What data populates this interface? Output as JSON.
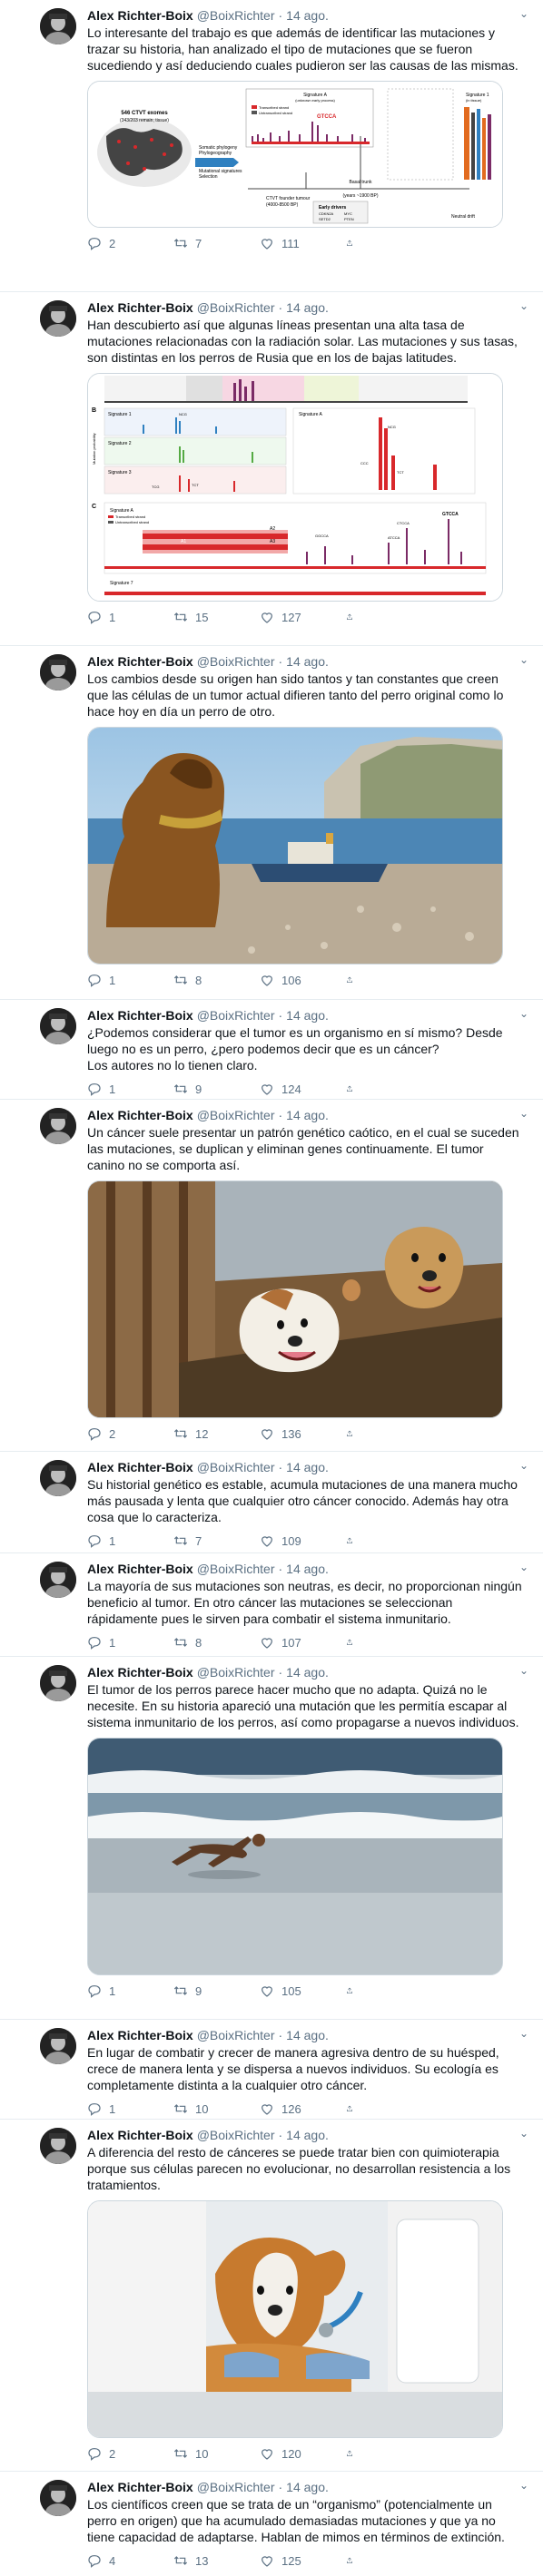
{
  "author": {
    "name": "Alex Richter-Boix",
    "handle": "@BoixRichter",
    "sep": "·"
  },
  "tweets": [
    {
      "time": "14 ago.",
      "text": "Lo interesante del trabajo es que además de identificar las mutaciones y trazar su historia, han analizado el tipo de mutaciones que se fueron sucediendo y así deduciendo cuales pudieron ser las causas de las mismas.",
      "replies": "2",
      "retweets": "7",
      "likes": "111",
      "figure": {
        "map_title": "546 CTVT exomes",
        "map_sub": "(343/203 remain; tissue)",
        "arrow_lines": [
          "Somatic phylogeny",
          "Phylogeography",
          "Mutational signatures",
          "Selection"
        ],
        "founder": "CTVT\nfounder tumour",
        "founder_date": "(4000-8500 BP)",
        "basal": "Basal trunk",
        "basal_date": "(years ~1900 BP)",
        "drivers": "Early drivers",
        "driver_genes": [
          "CDKN2A",
          "MYC",
          "SETD2",
          "PTEN",
          "RB1"
        ],
        "sigA": "Signature A",
        "sigA_sub": "(unknown early process)",
        "sig1": "Signature 1",
        "sig1_sub": "(in tissue)",
        "seq": "GTCCA",
        "drift": "Neutral drift",
        "leg1": "Transcribed strand",
        "leg2": "Untranscribed strand"
      }
    },
    {
      "time": "14 ago.",
      "text": "Han descubierto así que algunas líneas presentan una alta tasa de mutaciones relacionadas con la radiación solar. Las mutaciones y sus tasas, son distintas en los perros de Rusia que en los de bajas latitudes.",
      "replies": "1",
      "retweets": "15",
      "likes": "127",
      "figure": {
        "b": "B",
        "c": "C",
        "sig1": "Signature 1",
        "sig2": "Signature 2",
        "sig3": "Signature 3",
        "sigA": "Signature A",
        "sigA2": "Signature A",
        "sig7": "Signature 7",
        "ncg": "NCG",
        "tcg": "TCG",
        "tct": "TCT",
        "ccc": "CCC",
        "gccca": "GGCCA",
        "ctcca": "CTCCA",
        "gtcca": "GTCCA",
        "atcca": "ATCCA",
        "a1": "A1",
        "a2": "A2",
        "a3": "A3",
        "ylab": "Mutation probability",
        "leg1": "Transcribed strand",
        "leg2": "Untranscribed strand"
      }
    },
    {
      "time": "14 ago.",
      "text": "Los cambios desde su origen han sido tantos y tan constantes que creen que las células de un tumor actual difieren tanto del perro original como lo hace hoy en día un perro de otro.",
      "replies": "1",
      "retweets": "8",
      "likes": "106"
    },
    {
      "time": "14 ago.",
      "text": "¿Podemos considerar que el tumor es un organismo en sí mismo? Desde luego no es un perro, ¿pero podemos decir que es un cáncer?\nLos autores no lo tienen claro.",
      "replies": "1",
      "retweets": "9",
      "likes": "124"
    },
    {
      "time": "14 ago.",
      "text": "Un cáncer suele presentar un patrón genético caótico, en el cual se suceden las mutaciones, se duplican y eliminan genes continuamente. El tumor canino no se comporta así.",
      "replies": "2",
      "retweets": "12",
      "likes": "136"
    },
    {
      "time": "14 ago.",
      "text": "Su historial genético es estable, acumula mutaciones de una manera mucho más pausada y lenta que cualquier otro cáncer conocido. Además hay otra cosa que lo caracteriza.",
      "replies": "1",
      "retweets": "7",
      "likes": "109"
    },
    {
      "time": "14 ago.",
      "text": "La mayoría de sus mutaciones son neutras, es decir, no proporcionan ningún beneficio al tumor. En otro cáncer las mutaciones se seleccionan rápidamente pues le sirven para combatir el sistema inmunitario.",
      "replies": "1",
      "retweets": "8",
      "likes": "107"
    },
    {
      "time": "14 ago.",
      "text": "El tumor de los perros parece hacer mucho que no adapta. Quizá no le necesite. En su historia apareció una mutación que les permitía escapar al sistema inmunitario de los perros, así como propagarse a nuevos individuos.",
      "replies": "1",
      "retweets": "9",
      "likes": "105"
    },
    {
      "time": "14 ago.",
      "text": "En lugar de combatir y crecer de manera agresiva dentro de su huésped, crece de manera lenta y se dispersa a nuevos individuos. Su ecología es completamente distinta a la cualquier otro cáncer.",
      "replies": "1",
      "retweets": "10",
      "likes": "126"
    },
    {
      "time": "14 ago.",
      "text": "A diferencia del resto de cánceres se puede tratar bien con quimioterapia porque sus células parecen no evolucionar, no desarrollan resistencia a los tratamientos.",
      "replies": "2",
      "retweets": "10",
      "likes": "120"
    },
    {
      "time": "14 ago.",
      "text": "Los científicos creen que se trata de un “organismo” (potencialmente un perro en origen) que ha acumulado demasiadas mutaciones y que ya no tiene capacidad de adaptarse. Hablan de mimos en términos de extinción.",
      "replies": "4",
      "retweets": "13",
      "likes": "125"
    }
  ],
  "colors": {
    "text": "#0f1419",
    "muted": "#5b7083",
    "border": "#e6ecf0",
    "accent_red": "#d8282b"
  },
  "icons": {
    "reply": "reply-icon",
    "retweet": "retweet-icon",
    "like": "heart-icon",
    "share": "share-icon",
    "caret": "chevron-down-icon"
  }
}
